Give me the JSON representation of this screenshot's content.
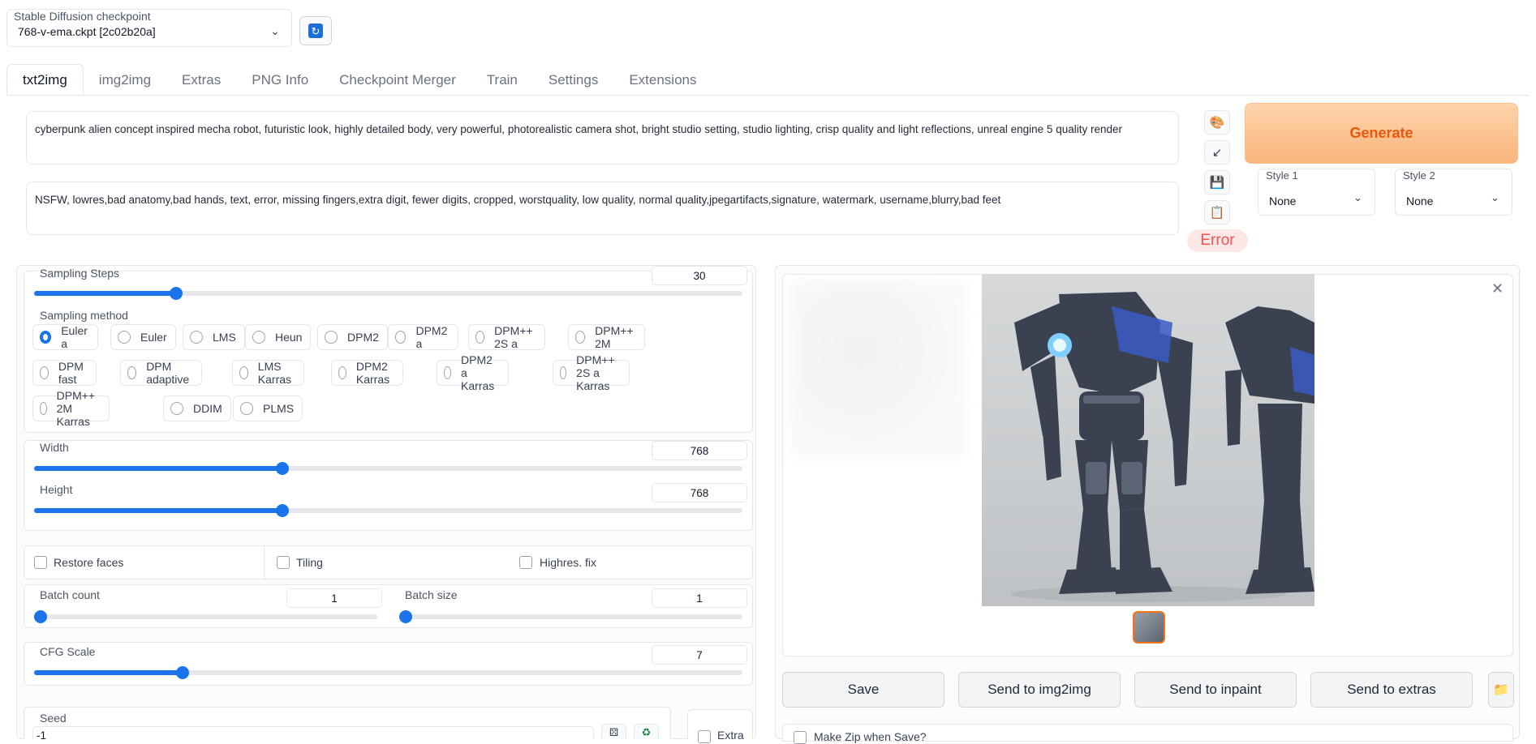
{
  "checkpoint": {
    "label": "Stable Diffusion checkpoint",
    "value": "768-v-ema.ckpt [2c02b20a]"
  },
  "tabs": [
    {
      "label": "txt2img",
      "active": true
    },
    {
      "label": "img2img"
    },
    {
      "label": "Extras"
    },
    {
      "label": "PNG Info"
    },
    {
      "label": "Checkpoint Merger"
    },
    {
      "label": "Train"
    },
    {
      "label": "Settings"
    },
    {
      "label": "Extensions"
    }
  ],
  "prompt": "cyberpunk alien concept inspired mecha robot, futuristic look, highly detailed body, very powerful, photorealistic camera shot, bright studio setting, studio lighting, crisp quality and light reflections, unreal engine 5 quality render",
  "negative_prompt": "NSFW, lowres,bad anatomy,bad hands, text, error, missing fingers,extra digit, fewer digits, cropped, worstquality, low quality, normal quality,jpegartifacts,signature, watermark, username,blurry,bad feet",
  "error_text": "Error",
  "generate_label": "Generate",
  "style1": {
    "label": "Style 1",
    "value": "None"
  },
  "style2": {
    "label": "Style 2",
    "value": "None"
  },
  "sampling_steps": {
    "label": "Sampling Steps",
    "value": "30",
    "fraction": 0.2
  },
  "sampling_method": {
    "label": "Sampling method",
    "selected": "Euler a",
    "options": [
      "Euler a",
      "Euler",
      "LMS",
      "Heun",
      "DPM2",
      "DPM2 a",
      "DPM++ 2S a",
      "DPM++ 2M",
      "DPM fast",
      "DPM adaptive",
      "LMS Karras",
      "DPM2 Karras",
      "DPM2 a Karras",
      "DPM++ 2S a Karras",
      "DPM++ 2M Karras",
      "DDIM",
      "PLMS"
    ]
  },
  "width": {
    "label": "Width",
    "value": "768",
    "fraction": 0.35
  },
  "height": {
    "label": "Height",
    "value": "768",
    "fraction": 0.35
  },
  "checks": {
    "restore_faces": "Restore faces",
    "tiling": "Tiling",
    "highres": "Highres. fix"
  },
  "batch_count": {
    "label": "Batch count",
    "value": "1",
    "fraction": 0
  },
  "batch_size": {
    "label": "Batch size",
    "value": "1",
    "fraction": 0
  },
  "cfg_scale": {
    "label": "CFG Scale",
    "value": "7",
    "fraction": 0.21
  },
  "seed": {
    "label": "Seed",
    "value": "-1"
  },
  "extra_label": "Extra",
  "actions": {
    "save": "Save",
    "img2img": "Send to img2img",
    "inpaint": "Send to inpaint",
    "extras": "Send to extras"
  },
  "make_zip": "Make Zip when Save?",
  "icons": {
    "refresh": "refresh-icon",
    "palette": "palette-icon",
    "arrow": "arrow-icon",
    "save": "floppy-icon",
    "paste": "clipboard-icon",
    "folder": "folder-icon",
    "dice": "dice-icon",
    "recycle": "recycle-icon",
    "close": "close-icon"
  }
}
